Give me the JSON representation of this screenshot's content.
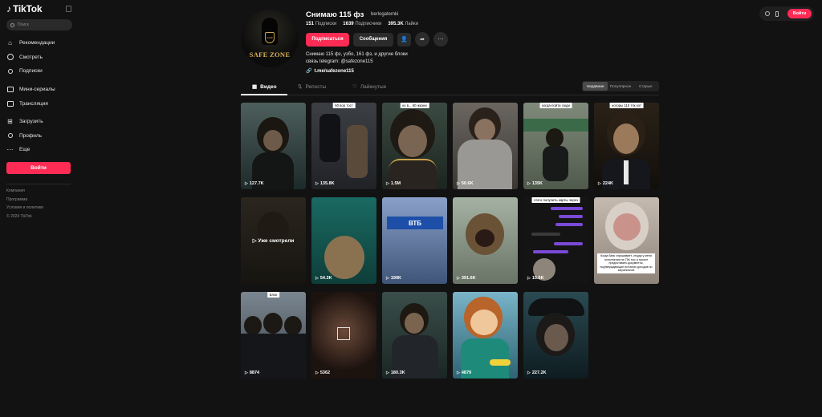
{
  "sidebar": {
    "logo": "TikTok",
    "search_placeholder": "Поиск",
    "nav": [
      {
        "label": "Рекомендации",
        "icon": "home-icon"
      },
      {
        "label": "Смотреть",
        "icon": "compass-icon"
      },
      {
        "label": "Подписки",
        "icon": "following-icon"
      },
      {
        "label": "Мини-сериалы",
        "icon": "series-icon"
      },
      {
        "label": "Трансляция",
        "icon": "live-icon"
      },
      {
        "label": "Загрузить",
        "icon": "upload-icon"
      },
      {
        "label": "Профиль",
        "icon": "profile-icon"
      },
      {
        "label": "Еще",
        "icon": "more-icon"
      }
    ],
    "login_label": "Войти",
    "footer": [
      "Компания",
      "Программа",
      "Условия и политики",
      "© 2024 TikTok"
    ]
  },
  "topbar": {
    "login_label": "Войти"
  },
  "profile": {
    "name": "Снимаю 115 фз",
    "handle": "berlogatemki",
    "avatar_text": "SAFE ZONE",
    "avatar_emblem": "SAFE",
    "stats": [
      {
        "value": "151",
        "label": "Подписки"
      },
      {
        "value": "1639",
        "label": "Подписчики"
      },
      {
        "value": "395.3K",
        "label": "Лайки"
      }
    ],
    "follow_label": "Подписаться",
    "message_label": "Сообщения",
    "bio_line1": "Снимаю 115 фз, узбо, 161 фз, и другие блоки",
    "bio_line2": "связь telegram: @safezone115",
    "link": "t.me/safezone115"
  },
  "tabs": [
    {
      "label": "Видео",
      "icon": "grid-icon"
    },
    {
      "label": "Репосты",
      "icon": "repost-icon"
    },
    {
      "label": "Лайкнутые",
      "icon": "heart-icon"
    }
  ],
  "sort_options": [
    "Недавние",
    "Популярное",
    "Старые"
  ],
  "videos": [
    {
      "views": "127.7K",
      "caption": ""
    },
    {
      "views": "135.8K",
      "caption": "60 вор тост"
    },
    {
      "views": "1.5M",
      "caption": "ко в... 60 жизни"
    },
    {
      "views": "50.6K",
      "caption": ""
    },
    {
      "views": "135K",
      "caption": "когда-пойти сюди"
    },
    {
      "views": "224K",
      "caption": "ногоры 115 тпк кот"
    },
    {
      "views": "",
      "caption": "",
      "overlay": "Уже смотрели"
    },
    {
      "views": "54.3K",
      "caption": ""
    },
    {
      "views": "199K",
      "caption": ""
    },
    {
      "views": "391.6K",
      "caption": ""
    },
    {
      "views": "15.6K",
      "caption": "этого получить карты через"
    },
    {
      "views": "",
      "caption": "Когда банк спрашивает, откуда у меня пополнения на 75К тыс и просит предоставить документы, подтверждающие источник доходов по заграничной"
    },
    {
      "views": "8874",
      "caption": "Блок"
    },
    {
      "views": "5362",
      "caption": ""
    },
    {
      "views": "180.3K",
      "caption": ""
    },
    {
      "views": "4879",
      "caption": ""
    },
    {
      "views": "227.2K",
      "caption": ""
    }
  ]
}
